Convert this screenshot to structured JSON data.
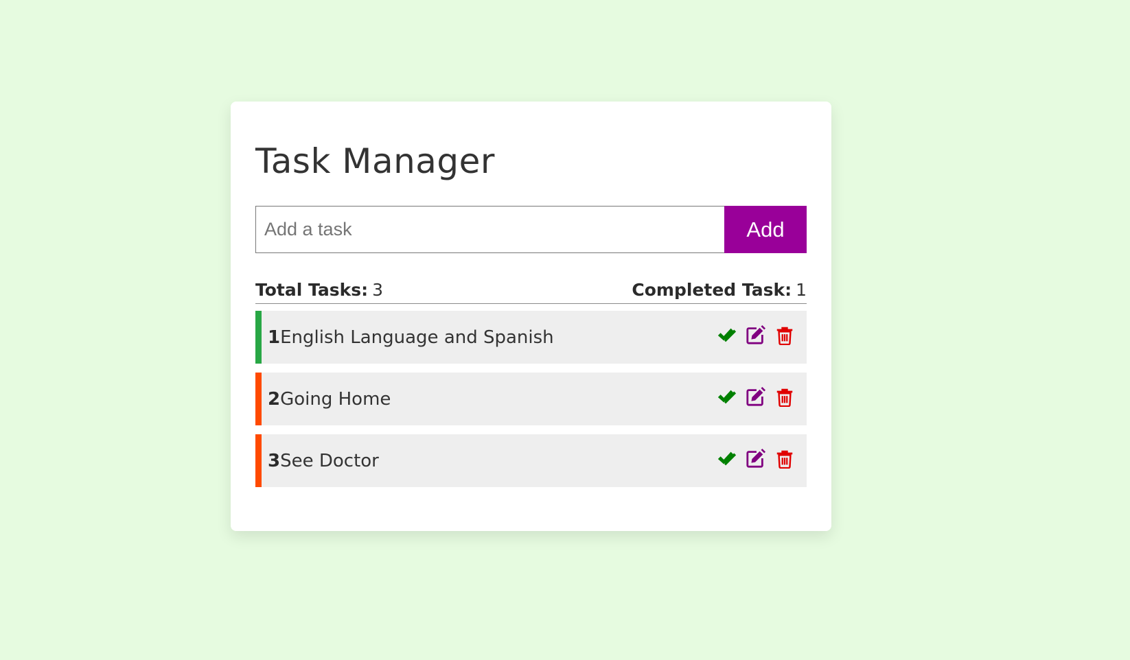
{
  "app": {
    "title": "Task Manager"
  },
  "input": {
    "placeholder": "Add a task",
    "value": "",
    "add_label": "Add"
  },
  "stats": {
    "total_label": "Total Tasks:",
    "total_value": "3",
    "completed_label": "Completed Task:",
    "completed_value": "1"
  },
  "tasks": [
    {
      "number": "1",
      "text": "English Language and Spanish",
      "completed": true
    },
    {
      "number": "2",
      "text": "Going Home",
      "completed": false
    },
    {
      "number": "3",
      "text": "See Doctor",
      "completed": false
    }
  ],
  "icons": {
    "complete": "double-check-icon",
    "edit": "edit-icon",
    "delete": "trash-icon"
  },
  "colors": {
    "background": "#e6fbe0",
    "accent": "#990099",
    "completed_bar": "#28a745",
    "pending_bar": "#ff4a00",
    "check_icon": "#008000",
    "edit_icon": "#800080",
    "delete_icon": "#e00000"
  }
}
